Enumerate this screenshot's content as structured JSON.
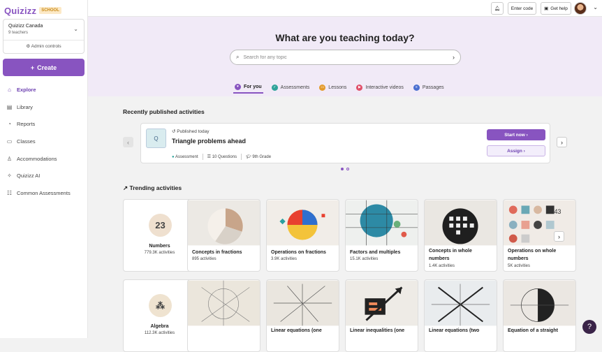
{
  "brand": {
    "name": "Quizizz",
    "badge": "SCHOOL"
  },
  "org": {
    "name": "Quizizz Canada",
    "sub": "9 teachers",
    "admin": "Admin controls"
  },
  "create_label": "Create",
  "nav": [
    {
      "label": "Explore",
      "icon": "home-icon"
    },
    {
      "label": "Library",
      "icon": "library-icon"
    },
    {
      "label": "Reports",
      "icon": "reports-icon"
    },
    {
      "label": "Classes",
      "icon": "classes-icon"
    },
    {
      "label": "Accommodations",
      "icon": "accommodations-icon"
    },
    {
      "label": "Quizizz AI",
      "icon": "ai-icon"
    },
    {
      "label": "Common Assessments",
      "icon": "assessments-icon"
    }
  ],
  "topbar": {
    "enter_code": "Enter code",
    "get_help": "Get help"
  },
  "hero": {
    "title": "What are you teaching today?",
    "search_placeholder": "Search for any topic"
  },
  "tabs": [
    {
      "label": "For you",
      "color": "#8854c0"
    },
    {
      "label": "Assessments",
      "color": "#2fa39a"
    },
    {
      "label": "Lessons",
      "color": "#e39a2a"
    },
    {
      "label": "Interactive videos",
      "color": "#e0506a"
    },
    {
      "label": "Passages",
      "color": "#4a6fd0"
    }
  ],
  "recent": {
    "section_title": "Recently published activities",
    "published": "Published today",
    "title": "Triangle problems ahead",
    "type": "Assessment",
    "questions": "10 Questions",
    "grade": "9th Grade",
    "start_label": "Start now",
    "assign_label": "Assign"
  },
  "trending": {
    "section_title": "Trending activities",
    "row1": [
      {
        "name": "Numbers",
        "count": "779.3K activities"
      },
      {
        "name": "Concepts in fractions",
        "count": "895 activities"
      },
      {
        "name": "Operations on fractions",
        "count": "3.9K activities"
      },
      {
        "name": "Factors and multiples",
        "count": "15.1K activities"
      },
      {
        "name": "Concepts in whole numbers",
        "count": "1.4K activities"
      },
      {
        "name": "Operations on whole numbers",
        "count": "5K activities"
      }
    ],
    "row2": [
      {
        "name": "Algebra",
        "count": "112.3K activities"
      },
      {
        "name": "",
        "count": ""
      },
      {
        "name": "Linear equations (one",
        "count": ""
      },
      {
        "name": "Linear inequalities (one",
        "count": ""
      },
      {
        "name": "Linear equations (two",
        "count": ""
      },
      {
        "name": "Equation of a straight",
        "count": ""
      }
    ]
  },
  "help_label": "?"
}
